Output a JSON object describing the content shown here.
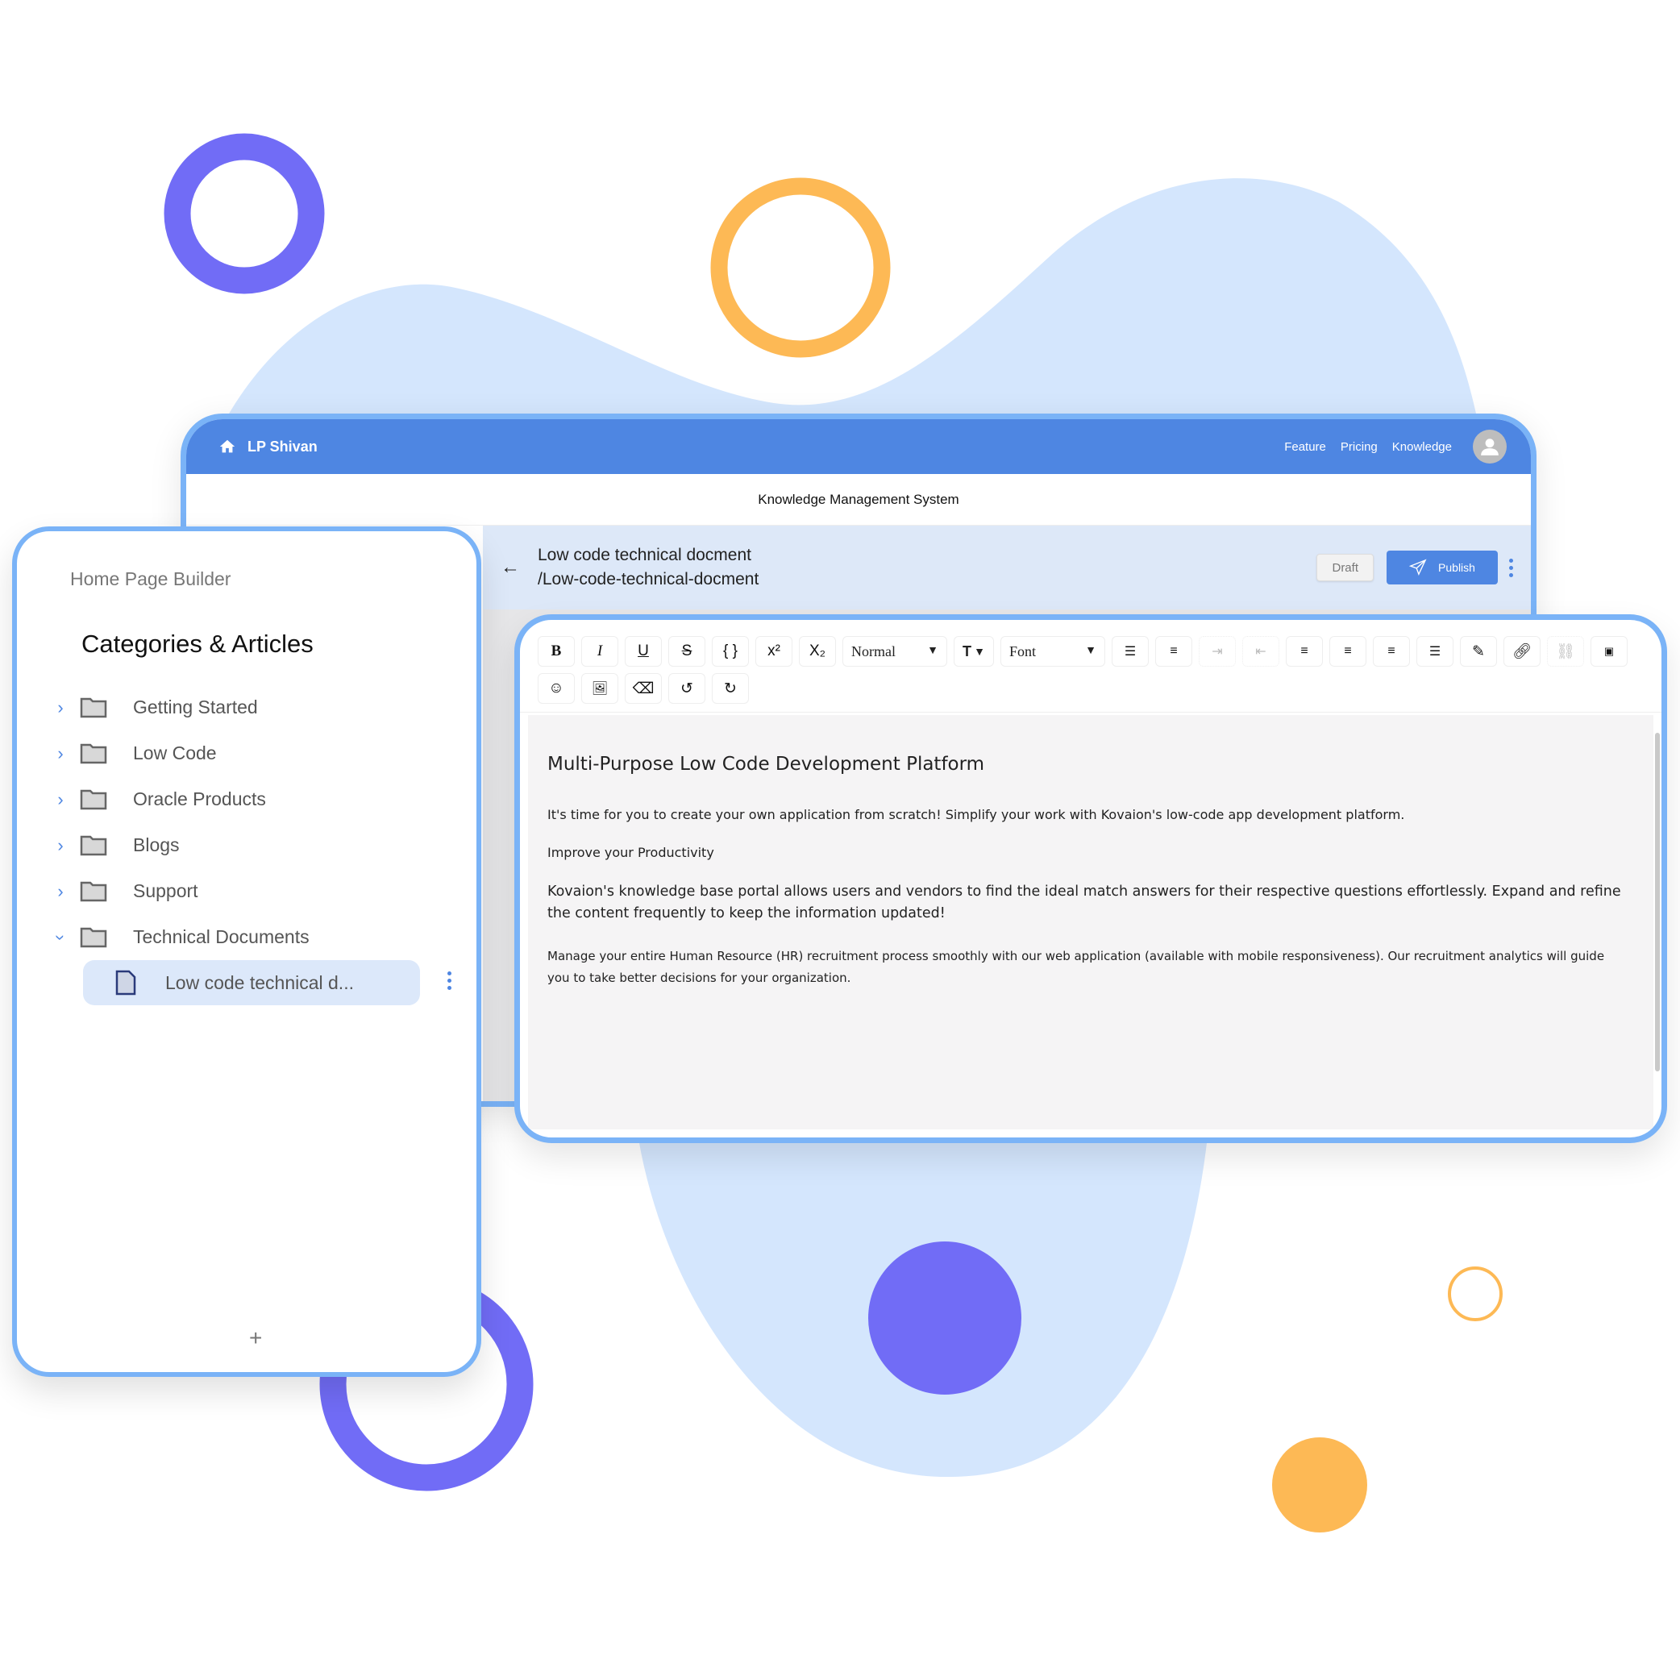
{
  "colors": {
    "accent_blue": "#4e86e2",
    "frame_blue": "#7ab3f7",
    "blob_blue": "#d4e6fd",
    "purple": "#716cf6",
    "orange": "#fdb955"
  },
  "topbar": {
    "home_icon": "home-icon",
    "brand": "LP Shivan",
    "nav": [
      "Feature",
      "Pricing",
      "Knowledge"
    ],
    "avatar_icon": "user-avatar-icon"
  },
  "system_title": "Knowledge Management System",
  "doc_bar": {
    "back_icon": "arrow-left-icon",
    "title": "Low code technical docment",
    "slug": "/Low-code-technical-docment",
    "draft_label": "Draft",
    "publish_label": "Publish",
    "publish_icon": "paper-plane-icon",
    "more_icon": "kebab-icon"
  },
  "left_panel": {
    "breadcrumb": "Home Page Builder",
    "title": "Categories & Articles",
    "categories": [
      {
        "label": "Getting Started",
        "expanded": false
      },
      {
        "label": "Low Code",
        "expanded": false
      },
      {
        "label": "Oracle Products",
        "expanded": false
      },
      {
        "label": "Blogs",
        "expanded": false
      },
      {
        "label": "Support",
        "expanded": false
      },
      {
        "label": "Technical Documents",
        "expanded": true
      }
    ],
    "selected_article": "Low code technical d...",
    "add_label": "+"
  },
  "editor": {
    "toolbar_row1": [
      "bold",
      "italic",
      "underline",
      "strikethrough",
      "code-block",
      "superscript",
      "subscript"
    ],
    "format_select": "Normal",
    "font_select": "Font",
    "toolbar_row1_rest": [
      "bullet-list",
      "ordered-list",
      "indent",
      "outdent",
      "align-left",
      "align-center",
      "align-right",
      "align-justify",
      "color-picker",
      "link",
      "unlink",
      "html-source"
    ],
    "toolbar_row2": [
      "emoji",
      "image",
      "clear-format",
      "undo",
      "redo"
    ],
    "content": {
      "heading": "Multi-Purpose Low Code Development Platform",
      "p1": "It's time for you to create your own application from scratch! Simplify your work with Kovaion's low-code app development platform.",
      "p2": "Improve your Productivity",
      "p3": "Kovaion's knowledge base portal allows users and vendors to find the ideal match answers for their respective questions effortlessly. Expand and refine the content frequently to keep the information updated!",
      "p4": "Manage your entire Human Resource (HR) recruitment process smoothly with our web application (available with mobile responsiveness). Our recruitment analytics will guide you to take better decisions for your organization."
    }
  }
}
